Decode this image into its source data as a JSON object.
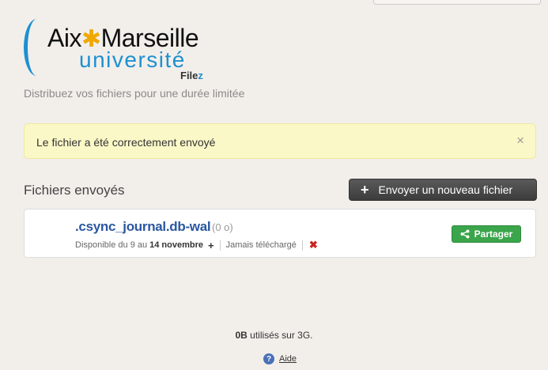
{
  "logo": {
    "line1_left": "Aix",
    "line1_star": "✱",
    "line1_right": "Marseille",
    "line2": "université",
    "product_prefix": "File",
    "product_suffix": "z"
  },
  "tagline": "Distribuez vos fichiers pour une durée limitée",
  "alert": {
    "message": "Le fichier a été correctement envoyé",
    "close_glyph": "×"
  },
  "files_section": {
    "title": "Fichiers envoyés",
    "upload_button": "Envoyer un nouveau fichier",
    "upload_icon": "+"
  },
  "files": [
    {
      "name": ".csync_journal.db-wal",
      "size": "(0 o)",
      "available_prefix": "Disponible du 9 au",
      "available_until": "14 novembre",
      "extend_icon": "+",
      "download_status": "Jamais téléchargé",
      "delete_icon": "✖",
      "share_button": "Partager"
    }
  ],
  "footer": {
    "usage_bold": "0B",
    "usage_rest": " utilisés sur 3G.",
    "help_icon": "?",
    "help_label": "Aide"
  },
  "colors": {
    "background": "#f2efeb",
    "brand_blue": "#1e90d0",
    "brand_star": "#f0a800",
    "alert_bg": "#fbf8c7",
    "link_blue": "#2a57a0",
    "share_green": "#3aa54a",
    "delete_red": "#cc2222"
  }
}
